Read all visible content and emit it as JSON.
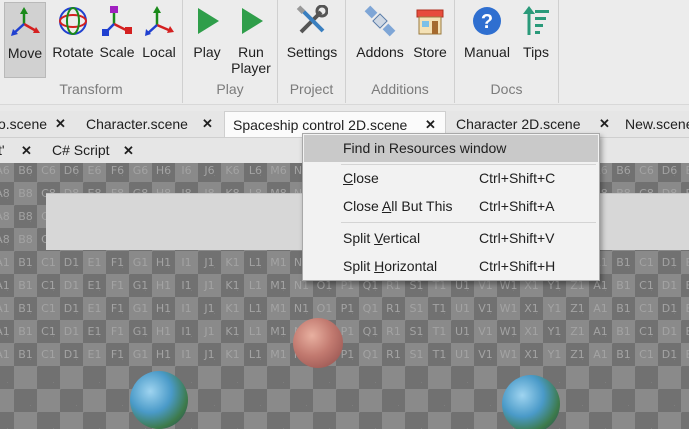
{
  "ribbon": {
    "groups": [
      {
        "label": "Transform",
        "buttons": [
          {
            "label": "Move",
            "icon": "move-gizmo-icon",
            "active": true
          },
          {
            "label": "Rotate",
            "icon": "rotate-gizmo-icon"
          },
          {
            "label": "Scale",
            "icon": "scale-gizmo-icon"
          },
          {
            "label": "Local",
            "icon": "local-axes-icon"
          }
        ]
      },
      {
        "label": "Play",
        "buttons": [
          {
            "label": "Play",
            "icon": "play-icon"
          },
          {
            "label": "Run Player",
            "icon": "run-player-icon"
          }
        ]
      },
      {
        "label": "Project",
        "buttons": [
          {
            "label": "Settings",
            "icon": "tools-icon"
          }
        ]
      },
      {
        "label": "Additions",
        "buttons": [
          {
            "label": "Addons",
            "icon": "satellite-icon"
          },
          {
            "label": "Store",
            "icon": "store-icon"
          }
        ]
      },
      {
        "label": "Docs",
        "buttons": [
          {
            "label": "Manual",
            "icon": "help-icon"
          },
          {
            "label": "Tips",
            "icon": "tips-icon"
          }
        ]
      }
    ]
  },
  "tabs": {
    "row1": [
      {
        "label": "o.scene"
      },
      {
        "label": "Character.scene"
      },
      {
        "label": "Spaceship control 2D.scene",
        "active": true
      },
      {
        "label": "Character 2D.scene"
      },
      {
        "label": "New.scene"
      }
    ],
    "row2": [
      {
        "label": "t'"
      },
      {
        "label": "C# Script"
      }
    ],
    "close_glyph": "✕"
  },
  "context_menu": {
    "items": [
      {
        "pre": "",
        "u": "",
        "post": "Find in Resources window",
        "shortcut": "",
        "highlighted": true
      },
      {
        "pre": "",
        "u": "C",
        "post": "lose",
        "shortcut": "Ctrl+Shift+C"
      },
      {
        "pre": "Close ",
        "u": "A",
        "post": "ll But This",
        "shortcut": "Ctrl+Shift+A"
      },
      {
        "pre": "Split ",
        "u": "V",
        "post": "ertical",
        "shortcut": "Ctrl+Shift+V"
      },
      {
        "pre": "Split ",
        "u": "H",
        "post": "orizontal",
        "shortcut": "Ctrl+Shift+H"
      }
    ]
  },
  "viewport": {
    "grid_rows": [
      {
        "row": "E",
        "index": 6
      },
      {
        "row": "F",
        "index": 8
      },
      {
        "row": "G",
        "index": 8
      },
      {
        "row": "H",
        "index": 8
      },
      {
        "row": "A",
        "index": 1
      },
      {
        "row": "B",
        "index": 1
      },
      {
        "row": "C",
        "index": 1
      },
      {
        "row": "D",
        "index": 1
      },
      {
        "row": "E",
        "index": 1
      }
    ],
    "colors": {
      "checker_dark": "#717171",
      "checker_light": "#8a8a8a",
      "banner": "#d7d7d7"
    }
  }
}
